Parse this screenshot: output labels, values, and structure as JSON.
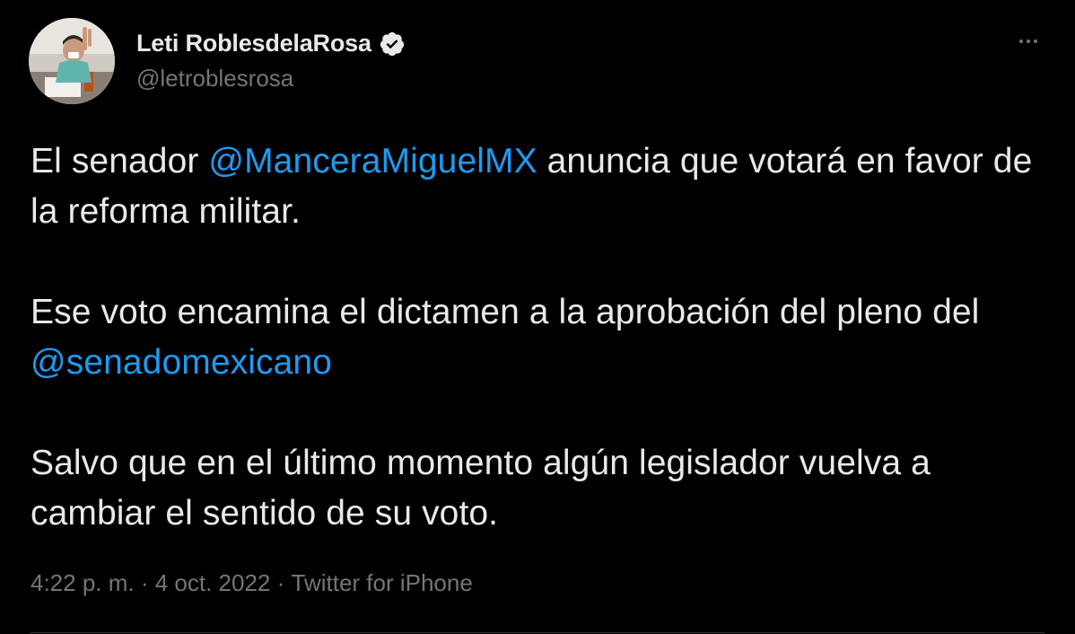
{
  "author": {
    "display_name": "Leti RoblesdelaRosa",
    "handle": "@letroblesrosa",
    "verified": true,
    "verified_color": "#1d9bf0"
  },
  "tweet": {
    "para1_pre": "El senador ",
    "para1_mention": "@ManceraMiguelMX",
    "para1_post": " anuncia que votará en favor de la reforma militar.",
    "para2_pre": "Ese voto encamina el dictamen a la aprobación del pleno del ",
    "para2_mention": "@senadomexicano",
    "para3": "Salvo que en el último momento algún legislador vuelva a cambiar el sentido de su voto."
  },
  "meta": {
    "time": "4:22 p. m.",
    "sep1": " · ",
    "date": "4 oct. 2022",
    "sep2": " · ",
    "source": "Twitter for iPhone"
  },
  "icons": {
    "more": "more-horizontal-icon",
    "verified": "verified-badge-icon"
  },
  "colors": {
    "background": "#000000",
    "text": "#e7e9ea",
    "secondary": "#71767b",
    "link": "#1d9bf0"
  }
}
